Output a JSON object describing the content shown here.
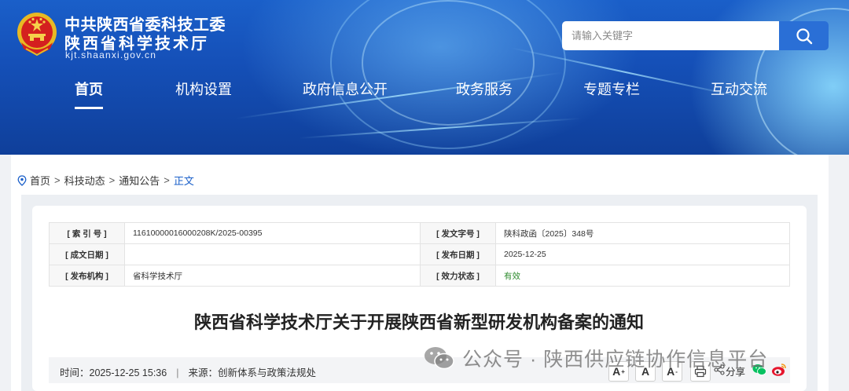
{
  "header": {
    "site_name_line1": "中共陕西省委科技工委",
    "site_name_line2": "陕西省科学技术厅",
    "domain": "kjt.shaanxi.gov.cn",
    "search_placeholder": "请输入关键字"
  },
  "nav": {
    "items": [
      {
        "label": "首页",
        "active": true
      },
      {
        "label": "机构设置"
      },
      {
        "label": "政府信息公开"
      },
      {
        "label": "政务服务"
      },
      {
        "label": "专题专栏"
      },
      {
        "label": "互动交流"
      }
    ]
  },
  "breadcrumb": {
    "items": [
      "首页",
      "科技动态",
      "通知公告",
      "正文"
    ],
    "separator": ">"
  },
  "meta": {
    "index_label": "[ 索 引 号 ]",
    "index_value": "11610000016000208K/2025-00395",
    "doc_no_label": "[ 发文字号 ]",
    "doc_no_value": "陕科政函〔2025〕348号",
    "written_date_label": "[ 成文日期 ]",
    "written_date_value": "",
    "publish_date_label": "[ 发布日期 ]",
    "publish_date_value": "2025-12-25",
    "publisher_label": "[ 发布机构 ]",
    "publisher_value": "省科学技术厅",
    "status_label": "[ 效力状态 ]",
    "status_value": "有效"
  },
  "article": {
    "title": "陕西省科学技术厅关于开展陕西省新型研发机构备案的通知",
    "time_label": "时间：",
    "time_value": "2025-12-25 15:36",
    "separator": "|",
    "source_label": "来源：",
    "source_value": "创新体系与政策法规处"
  },
  "toolbar": {
    "font_buttons": [
      "A",
      "A",
      "A"
    ],
    "share_label": "分享"
  },
  "watermark": {
    "text": "公众号 · 陕西供应链协作信息平台"
  },
  "colors": {
    "banner": "#1550b8",
    "accent": "#1a5fc9",
    "status_green": "#2e8b2e",
    "weibo_red": "#e6162d",
    "wechat_green": "#07c160"
  }
}
